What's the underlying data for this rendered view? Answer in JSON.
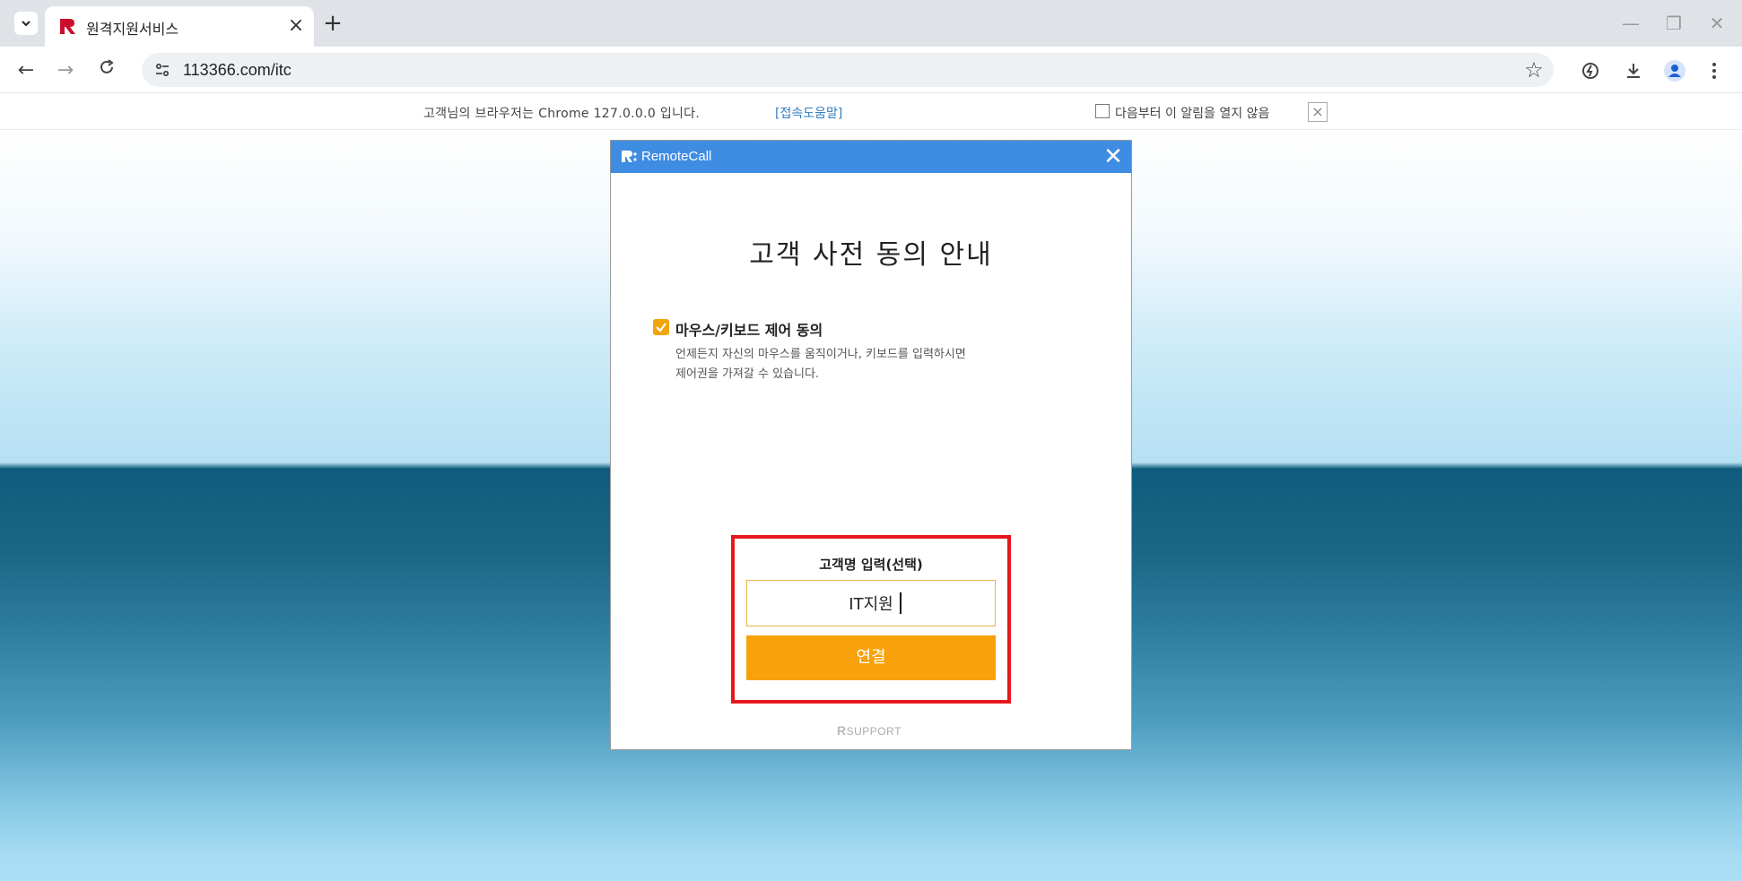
{
  "browser": {
    "tab": {
      "title": "원격지원서비스",
      "favicon": "rsupport-r-logo",
      "close": "×"
    },
    "new_tab": "+",
    "window_controls": {
      "minimize": "—",
      "restore": "❐",
      "close": "✕"
    },
    "nav": {
      "back": "←",
      "forward": "→",
      "reload": "C"
    },
    "url": "113366.com/itc",
    "bookmark_star": "☆",
    "toolbar_icons": [
      "performance-icon",
      "download-icon",
      "profile-icon",
      "menu-icon"
    ]
  },
  "notice": {
    "text": "고객님의 브라우저는 Chrome 127.0.0.0 입니다.",
    "help_link": "[접속도움말]",
    "dont_show_label": "다음부터 이 알림을 열지 않음",
    "close": "×"
  },
  "dialog": {
    "title": "RemoteCall",
    "close": "✕",
    "heading": "고객 사전 동의 안내",
    "consent": {
      "checked": true,
      "title": "마우스/키보드 제어 동의",
      "description_line1": "언제든지 자신의 마우스를 움직이거나, 키보드를 입력하시면",
      "description_line2": "제어권을 가져갈 수 있습니다."
    },
    "name_label": "고객명 입력(선택)",
    "name_value": "IT지원",
    "connect_button": "연결",
    "footer_brand": "SUPPORT"
  },
  "colors": {
    "accent_orange": "#f9a10b",
    "dialog_header": "#3f8ce3",
    "highlight_red": "#e5191b",
    "link_blue": "#2f7cc1"
  }
}
